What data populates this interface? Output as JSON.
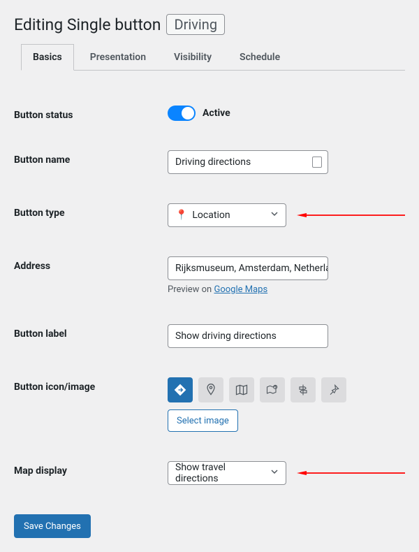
{
  "title": {
    "prefix": "Editing Single button",
    "badge": "Driving"
  },
  "tabs": [
    {
      "label": "Basics",
      "active": true
    },
    {
      "label": "Presentation",
      "active": false
    },
    {
      "label": "Visibility",
      "active": false
    },
    {
      "label": "Schedule",
      "active": false
    }
  ],
  "fields": {
    "button_status": {
      "label": "Button status",
      "value_label": "Active"
    },
    "button_name": {
      "label": "Button name",
      "value": "Driving directions"
    },
    "button_type": {
      "label": "Button type",
      "icon": "📍",
      "value": "Location"
    },
    "address": {
      "label": "Address",
      "value": "Rijksmuseum, Amsterdam, Netherlands",
      "preview_prefix": "Preview on ",
      "preview_link": "Google Maps"
    },
    "button_label": {
      "label": "Button label",
      "value": "Show driving directions"
    },
    "button_icon": {
      "label": "Button icon/image",
      "select_image": "Select image"
    },
    "map_display": {
      "label": "Map display",
      "value": "Show travel directions"
    }
  },
  "save": "Save Changes"
}
